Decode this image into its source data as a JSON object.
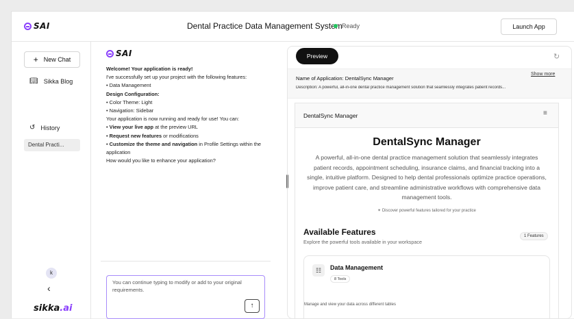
{
  "header": {
    "logo_text": "SAI",
    "title": "Dental Practice Data Management System",
    "status": "Ready",
    "launch_label": "Launch App"
  },
  "sidebar": {
    "new_chat_label": "New Chat",
    "blog_label": "Sikka Blog",
    "history_label": "History",
    "history_items": [
      "Dental Practi..."
    ],
    "avatar_initial": "k",
    "brand_prefix": "sikka",
    "brand_suffix": ".ai"
  },
  "chat": {
    "logo_text": "SAI",
    "welcome": "Welcome! Your application is ready!",
    "intro": "I've successfully set up your project with the following features:",
    "feature_1": "• Data Management",
    "design_heading": "Design Configuration:",
    "theme": "• Color Theme: Light",
    "navigation": "• Navigation: Sidebar",
    "running": "Your application is now running and ready for use! You can:",
    "action_1_bold": "View your live app",
    "action_1_rest": " at the preview URL",
    "action_2_bold": "Request new features",
    "action_2_rest": " or modifications",
    "action_3_bold": "Customize the theme and navigation",
    "action_3_rest": " in Profile Settings within the application",
    "question": "How would you like to enhance your application?",
    "input_placeholder": "You can continue typing to modify or add to your original requirements."
  },
  "preview": {
    "tab_label": "Preview",
    "app_name": "Name of Application: DentalSync Manager",
    "show_more": "Show more",
    "description": "Description: A powerful, all-in-one dental practice management solution that seamlessly integrates patient records...",
    "inner_title": "DentalSync Manager",
    "hero_title": "DentalSync Manager",
    "hero_desc": "A powerful, all-in-one dental practice management solution that seamlessly integrates patient records, appointment scheduling, insurance claims, and financial tracking into a single, intuitive platform. Designed to help dental professionals optimize practice operations, improve patient care, and streamline administrative workflows with comprehensive data management tools.",
    "hero_note": "Discover powerful features tailored for your practice",
    "features_title": "Available Features",
    "features_sub": "Explore the powerful tools available in your workspace",
    "features_count": "1 Features",
    "card_title": "Data Management",
    "card_tools": "8 Tools",
    "card_desc": "Manage and view your data across different tables"
  },
  "colors": {
    "accent": "#8a3ffc",
    "status_ready": "#22c55e"
  }
}
